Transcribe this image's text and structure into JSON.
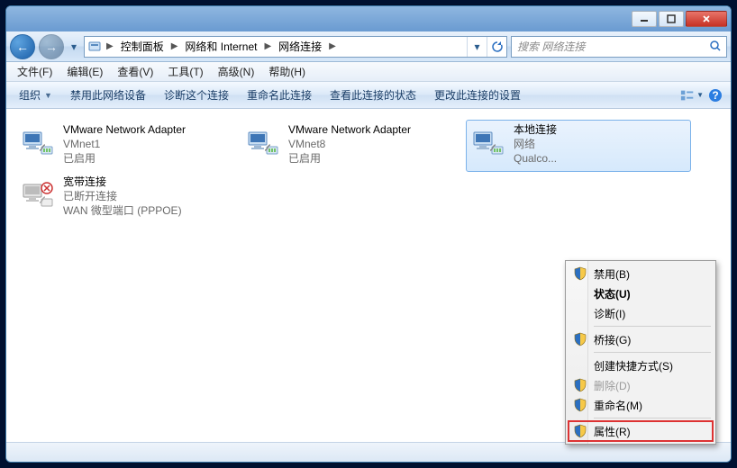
{
  "titlebar": {
    "minimize": "minimize",
    "maximize": "maximize",
    "close": "close"
  },
  "nav": {
    "breadcrumbs": [
      "控制面板",
      "网络和 Internet",
      "网络连接"
    ],
    "search_placeholder": "搜索 网络连接"
  },
  "menubar": {
    "file": "文件(F)",
    "edit": "编辑(E)",
    "view": "查看(V)",
    "tools": "工具(T)",
    "advanced": "高级(N)",
    "help": "帮助(H)"
  },
  "toolbar": {
    "organize": "组织",
    "disable": "禁用此网络设备",
    "diagnose": "诊断这个连接",
    "rename": "重命名此连接",
    "viewstatus": "查看此连接的状态",
    "changesettings": "更改此连接的设置"
  },
  "connections": [
    {
      "title": "VMware Network Adapter",
      "line2": "VMnet1",
      "line3": "已启用",
      "iconType": "net"
    },
    {
      "title": "VMware Network Adapter",
      "line2": "VMnet8",
      "line3": "已启用",
      "iconType": "net"
    },
    {
      "title": "本地连接",
      "line2": "网络",
      "line3": "Qualco...",
      "iconType": "net",
      "selected": true
    },
    {
      "title": "宽带连接",
      "line2": "已断开连接",
      "line3": "WAN 微型端口 (PPPOE)",
      "iconType": "wan"
    }
  ],
  "context_menu": {
    "items": [
      {
        "label": "禁用(B)",
        "shield": true
      },
      {
        "label": "状态(U)",
        "bold": true
      },
      {
        "label": "诊断(I)"
      },
      {
        "sep": true
      },
      {
        "label": "桥接(G)",
        "shield": true
      },
      {
        "sep": true
      },
      {
        "label": "创建快捷方式(S)"
      },
      {
        "label": "删除(D)",
        "shield": true,
        "disabled": true
      },
      {
        "label": "重命名(M)",
        "shield": true
      },
      {
        "sep": true
      },
      {
        "label": "属性(R)",
        "shield": true,
        "highlight": true
      }
    ]
  }
}
